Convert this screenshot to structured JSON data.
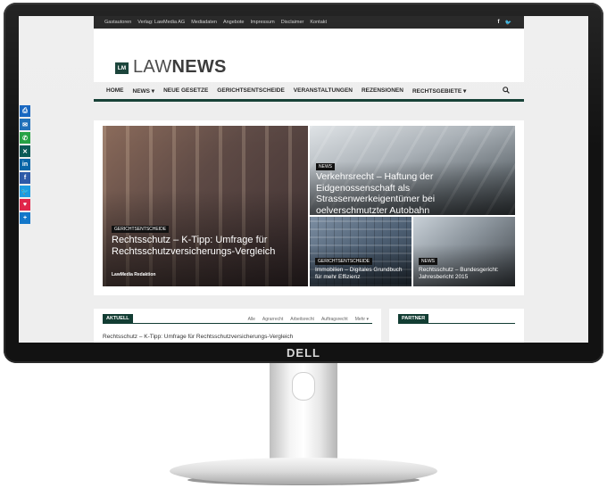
{
  "device": {
    "brand": "DELL"
  },
  "topbar": {
    "items": [
      "Gastautoren",
      "Verlag: LawMedia AG",
      "Mediadaten",
      "Angebote",
      "Impressum",
      "Disclaimer",
      "Kontakt"
    ],
    "social": [
      "f",
      "🐦"
    ]
  },
  "logo": {
    "box": "LM",
    "law": "LAW",
    "news": "NEWS"
  },
  "nav": {
    "items": [
      "HOME",
      "NEWS ▾",
      "NEUE GESETZE",
      "GERICHTSENTSCHEIDE",
      "VERANSTALTUNGEN",
      "REZENSIONEN",
      "RECHTSGEBIETE ▾"
    ]
  },
  "tiles": [
    {
      "badge": "GERICHTSENTSCHEIDE",
      "title": "Rechtsschutz – K-Tipp: Umfrage für Rechtsschutzversicherungs-Vergleich",
      "author": "LawMedia Redaktion"
    },
    {
      "badge": "NEWS",
      "title": "Verkehrsrecht – Haftung der Eidgenossenschaft als Strassenwerkeigentümer bei oelverschmutzter Autobahn"
    },
    {
      "badge": "GERICHTSENTSCHEIDE",
      "title": "Immobilien – Digitales Grundbuch für mehr Effizienz"
    },
    {
      "badge": "NEWS",
      "title": "Rechtsschutz – Bundesgericht: Jahresbericht 2015"
    }
  ],
  "aktuell": {
    "heading": "AKTUELL",
    "filters": [
      "Alle",
      "Agrarrecht",
      "Arbeitsrecht",
      "Auftragsrecht",
      "Mehr ▾"
    ],
    "first": "Rechtsschutz – K-Tipp: Umfrage für Rechtsschutzversicherungs-Vergleich"
  },
  "partner": {
    "heading": "PARTNER"
  },
  "share": {
    "buttons": [
      {
        "glyph": "⎙",
        "color": "#1565c0"
      },
      {
        "glyph": "✉",
        "color": "#1e6fb8"
      },
      {
        "glyph": "✆",
        "color": "#25a244"
      },
      {
        "glyph": "✕",
        "color": "#0b5a56"
      },
      {
        "glyph": "in",
        "color": "#0a66a8"
      },
      {
        "glyph": "f",
        "color": "#2d5aa8"
      },
      {
        "glyph": "🐦",
        "color": "#1d9be0"
      },
      {
        "glyph": "♥",
        "color": "#e0264a"
      },
      {
        "glyph": "+",
        "color": "#1377c9"
      }
    ]
  },
  "colors": {
    "brand_green": "#123d33"
  }
}
